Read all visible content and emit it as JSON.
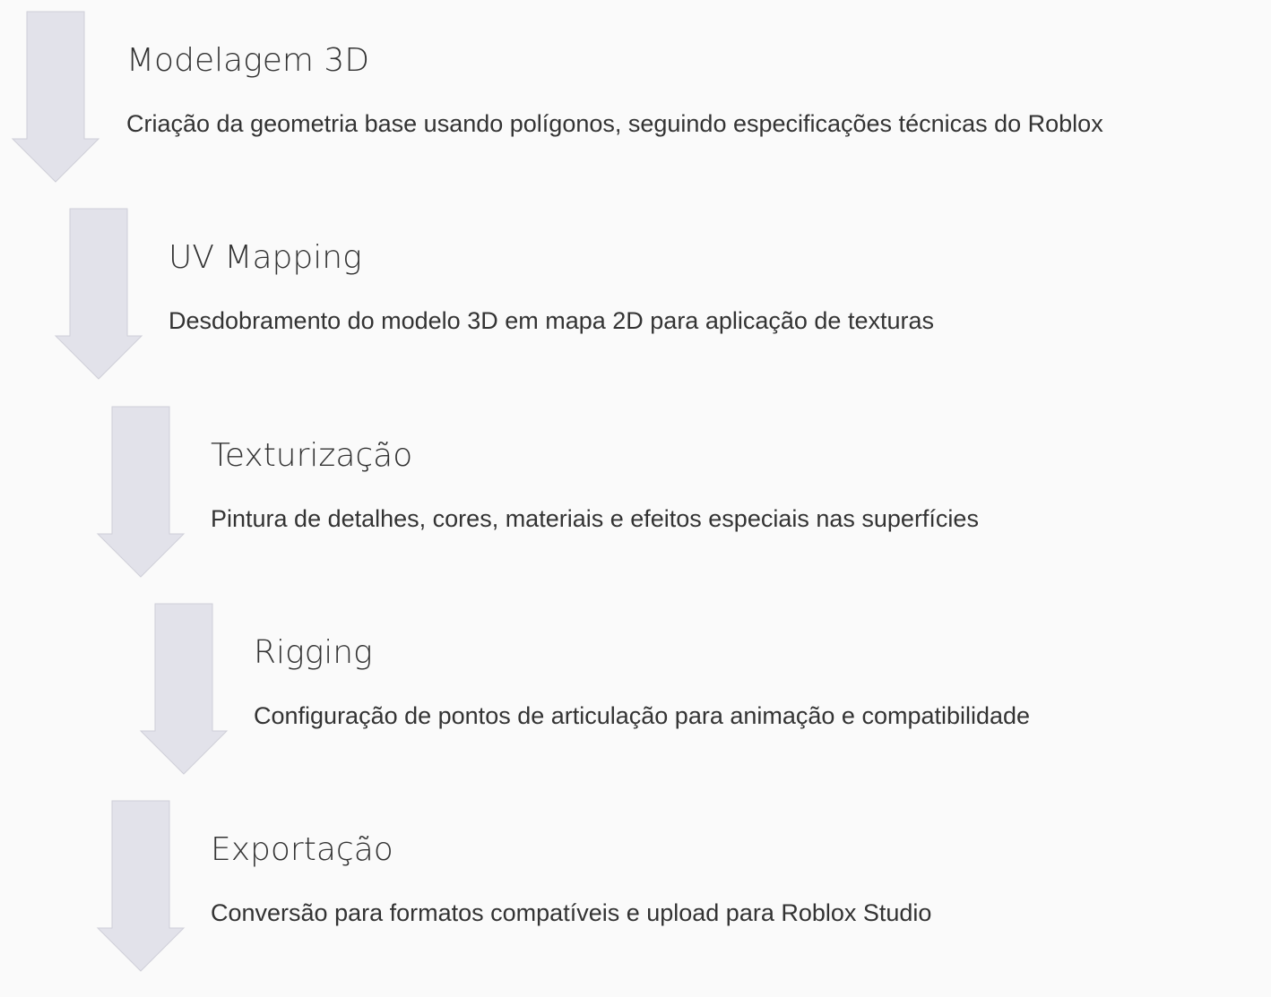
{
  "colors": {
    "background": "#fafafa",
    "arrow_fill": "#e2e2ea",
    "arrow_stroke": "#cfcfd8",
    "text": "#333333"
  },
  "steps": [
    {
      "title": "Modelagem 3D",
      "description": "Criação da geometria base usando polígonos, seguindo especificações técnicas do Roblox",
      "icon": "down-arrow-icon"
    },
    {
      "title": "UV Mapping",
      "description": "Desdobramento do modelo 3D em mapa 2D para aplicação de texturas",
      "icon": "down-arrow-icon"
    },
    {
      "title": "Texturização",
      "description": "Pintura de detalhes, cores, materiais e efeitos especiais nas superfícies",
      "icon": "down-arrow-icon"
    },
    {
      "title": "Rigging",
      "description": "Configuração de pontos de articulação para animação e compatibilidade",
      "icon": "down-arrow-icon"
    },
    {
      "title": "Exportação",
      "description": "Conversão para formatos compatíveis e upload para Roblox Studio",
      "icon": "down-arrow-icon"
    }
  ]
}
